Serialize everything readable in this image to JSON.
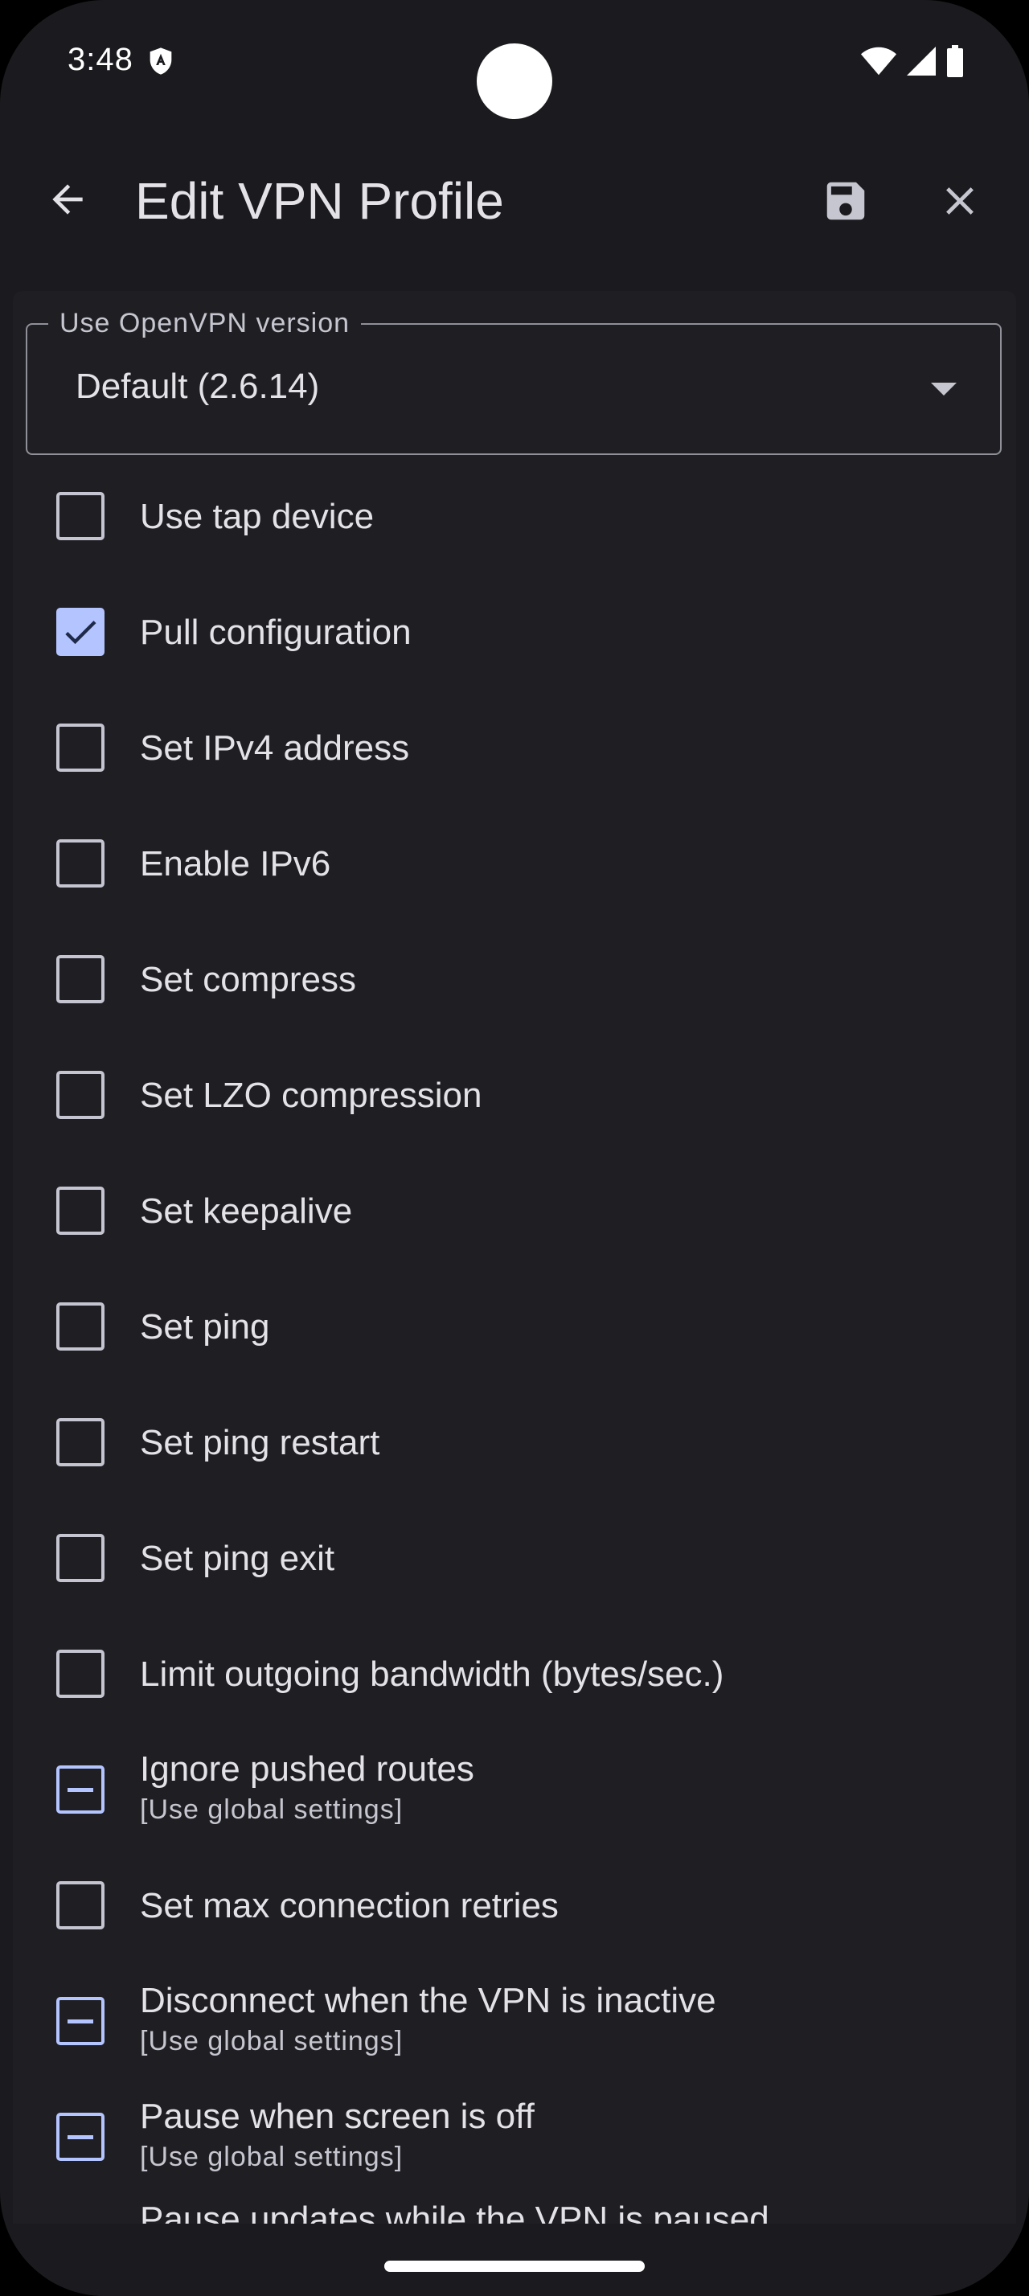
{
  "status_bar": {
    "time": "3:48",
    "shield_icon": "shield-icon",
    "wifi_icon": "wifi-icon",
    "signal_icon": "cell-signal-icon",
    "battery_icon": "battery-icon"
  },
  "app_bar": {
    "title": "Edit VPN Profile",
    "back_icon": "arrow-back-icon",
    "save_icon": "save-icon",
    "close_icon": "close-icon"
  },
  "version_field": {
    "label": "Use OpenVPN version",
    "value": "Default (2.6.14)"
  },
  "options": [
    {
      "label": "Use tap device",
      "state": "unchecked"
    },
    {
      "label": "Pull configuration",
      "state": "checked"
    },
    {
      "label": "Set IPv4 address",
      "state": "unchecked"
    },
    {
      "label": "Enable IPv6",
      "state": "unchecked"
    },
    {
      "label": "Set compress",
      "state": "unchecked"
    },
    {
      "label": "Set LZO compression",
      "state": "unchecked"
    },
    {
      "label": "Set keepalive",
      "state": "unchecked"
    },
    {
      "label": "Set ping",
      "state": "unchecked"
    },
    {
      "label": "Set ping restart",
      "state": "unchecked"
    },
    {
      "label": "Set ping exit",
      "state": "unchecked"
    },
    {
      "label": "Limit outgoing bandwidth (bytes/sec.)",
      "state": "unchecked"
    },
    {
      "label": "Ignore pushed routes",
      "sublabel": "[Use global settings]",
      "state": "indeterminate"
    },
    {
      "label": "Set max connection retries",
      "state": "unchecked"
    },
    {
      "label": "Disconnect when the VPN is inactive",
      "sublabel": "[Use global settings]",
      "state": "indeterminate"
    },
    {
      "label": "Pause when screen is off",
      "sublabel": "[Use global settings]",
      "state": "indeterminate"
    }
  ],
  "partial_item": "Pause updates while the VPN is paused",
  "colors": {
    "background": "#1b1b1f",
    "surface": "#1f1f23",
    "accent": "#b4c4ff",
    "text": "#e3e2e6",
    "secondary_text": "#c6c6d0"
  }
}
